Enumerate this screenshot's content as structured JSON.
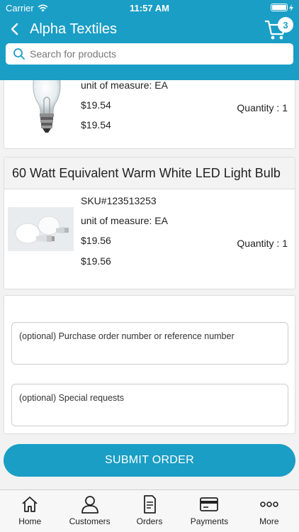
{
  "status_bar": {
    "carrier": "Carrier",
    "time": "11:57 AM"
  },
  "nav": {
    "title": "Alpha Textiles",
    "cart_count": "3"
  },
  "search": {
    "placeholder": "Search for products"
  },
  "items": [
    {
      "uom": "unit of measure: EA",
      "price": "$19.54",
      "total": "$19.54",
      "quantity": "Quantity : 1",
      "image_icon": "incandescent-bulb-image"
    },
    {
      "title": "60 Watt Equivalent Warm White LED Light Bulb",
      "sku": "SKU#123513253",
      "uom": "unit of measure: EA",
      "price": "$19.56",
      "total": "$19.56",
      "quantity": "Quantity : 1",
      "image_icon": "led-bulb-image"
    }
  ],
  "form": {
    "po_placeholder": "(optional) Purchase order number or reference number",
    "requests_placeholder": "(optional) Special requests"
  },
  "submit_label": "SUBMIT ORDER",
  "tabs": [
    {
      "label": "Home",
      "icon": "home-icon"
    },
    {
      "label": "Customers",
      "icon": "customers-icon"
    },
    {
      "label": "Orders",
      "icon": "orders-icon"
    },
    {
      "label": "Payments",
      "icon": "payments-icon"
    },
    {
      "label": "More",
      "icon": "more-icon"
    }
  ],
  "colors": {
    "accent": "#1a9ec5",
    "background": "#f2f2f2"
  }
}
